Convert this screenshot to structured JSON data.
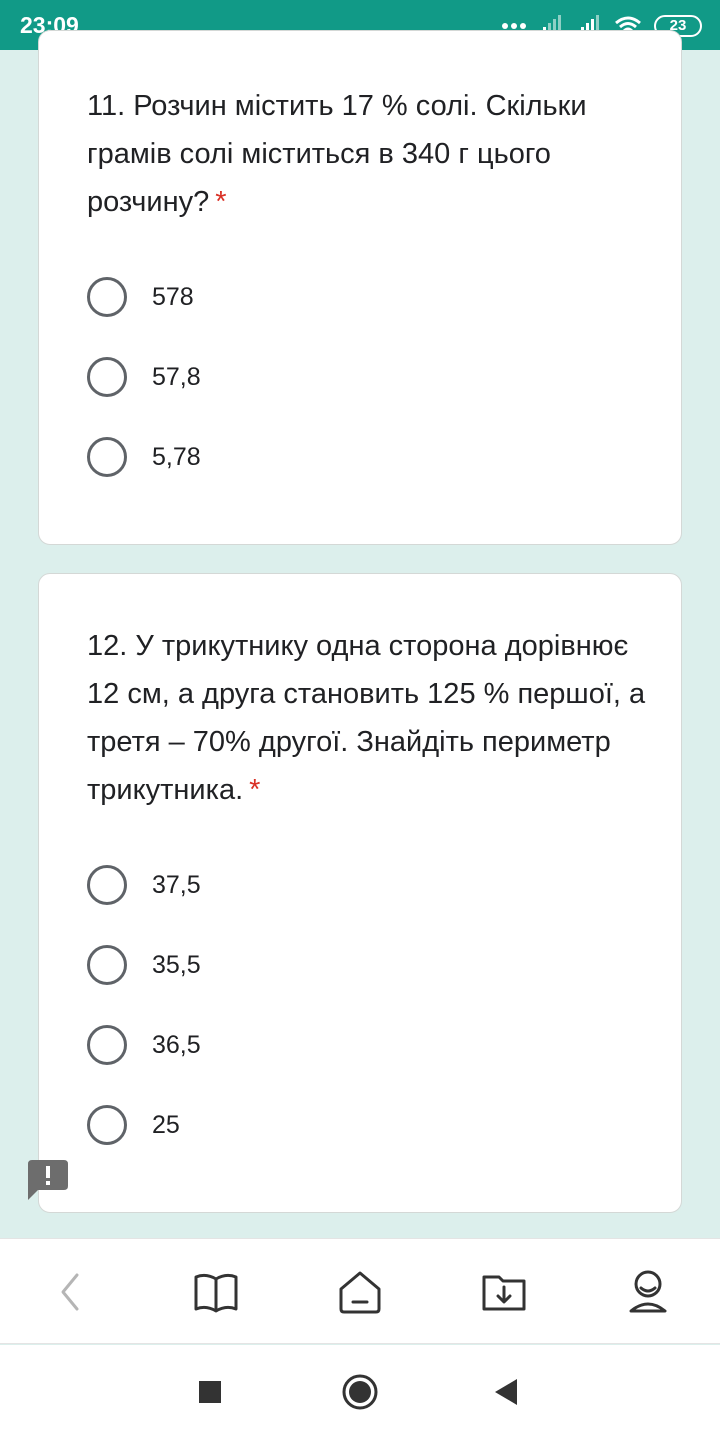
{
  "status_bar": {
    "time": "23:09",
    "battery": "23"
  },
  "questions": [
    {
      "text": "11. Розчин містить 17 % солі. Скільки грамів солі міститься в 340 г цього розчину?",
      "required_mark": "*",
      "options": [
        "578",
        "57,8",
        "5,78"
      ]
    },
    {
      "text": "12. У трикутнику одна сторона дорівнює 12 см, а друга становить 125 % першої, а третя – 70% другої. Знайдіть периметр трикутника.",
      "required_mark": "*",
      "options": [
        "37,5",
        "35,5",
        "36,5",
        "25"
      ]
    }
  ],
  "colors": {
    "status_bar": "#119a87",
    "page_bg": "#dcefec",
    "required": "#d93025",
    "radio": "#5f6368",
    "feedback": "#6d6d6d"
  }
}
